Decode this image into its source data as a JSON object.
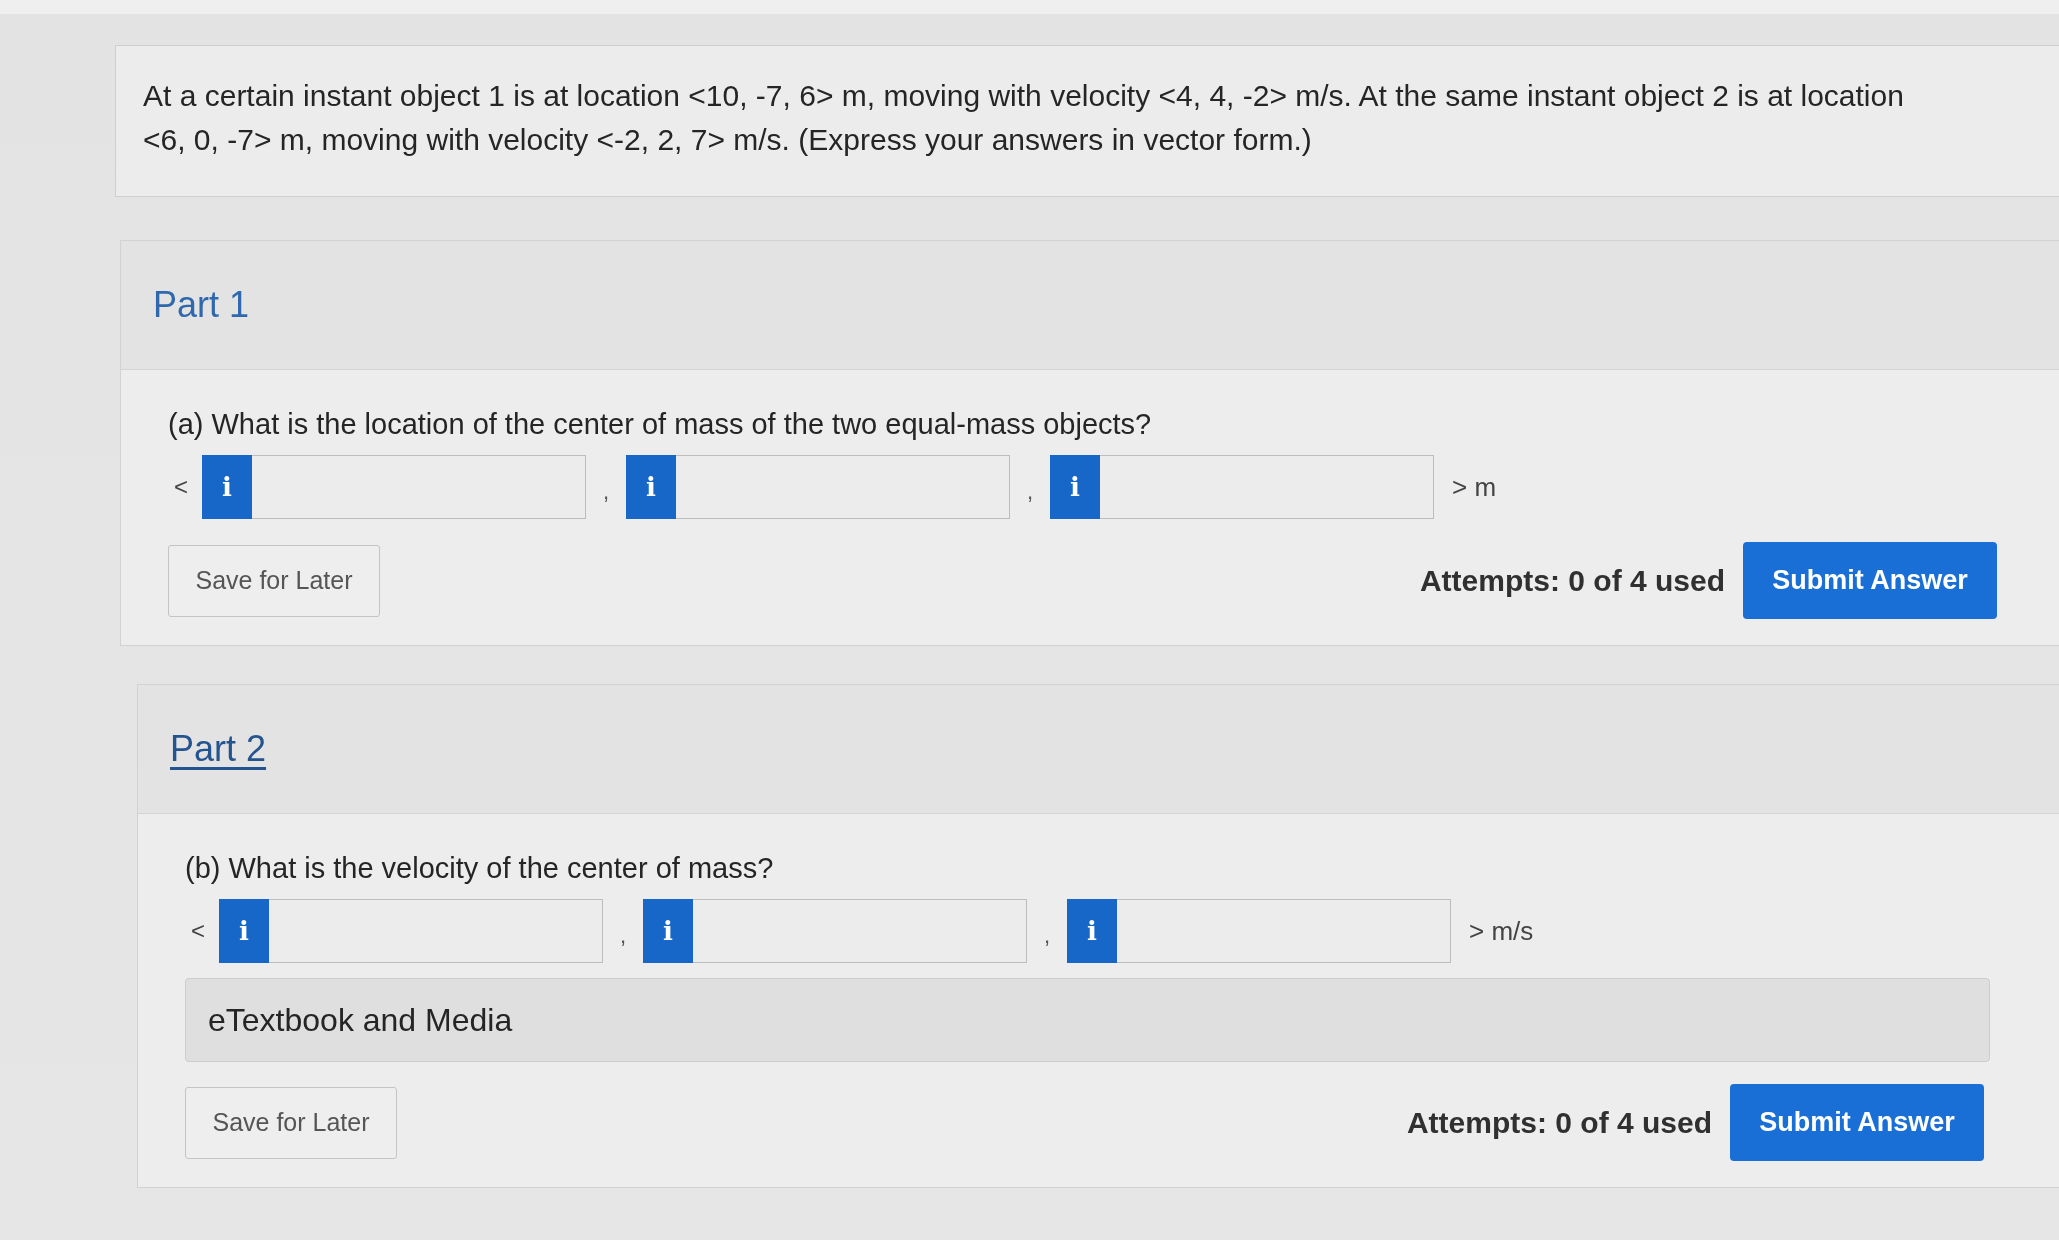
{
  "problem": {
    "text": "At a certain instant object 1 is at location <10, -7, 6> m, moving with velocity <4, 4, -2> m/s. At the same instant object 2 is at location <6, 0, -7> m, moving with velocity <-2, 2, 7> m/s. (Express your answers in vector form.)"
  },
  "parts": [
    {
      "title": "Part 1",
      "underlined": false,
      "question": "(a) What is the location of the center of mass of the two equal-mass objects?",
      "vector": {
        "open": "<",
        "close": "> m",
        "components": [
          {
            "info": "i"
          },
          {
            "separator": ",",
            "info": "i"
          },
          {
            "separator": ",",
            "info": "i"
          }
        ]
      },
      "save": "Save for Later",
      "attempts": "Attempts: 0 of 4 used",
      "submit": "Submit Answer"
    },
    {
      "title": "Part 2",
      "underlined": true,
      "question": "(b) What is the velocity of the center of mass?",
      "vector": {
        "open": "<",
        "close": "> m/s",
        "components": [
          {
            "info": "i"
          },
          {
            "separator": ",",
            "info": "i"
          },
          {
            "separator": ",",
            "info": "i"
          }
        ]
      },
      "media": "eTextbook and Media",
      "save": "Save for Later",
      "attempts": "Attempts: 0 of 4 used",
      "submit": "Submit Answer"
    }
  ]
}
